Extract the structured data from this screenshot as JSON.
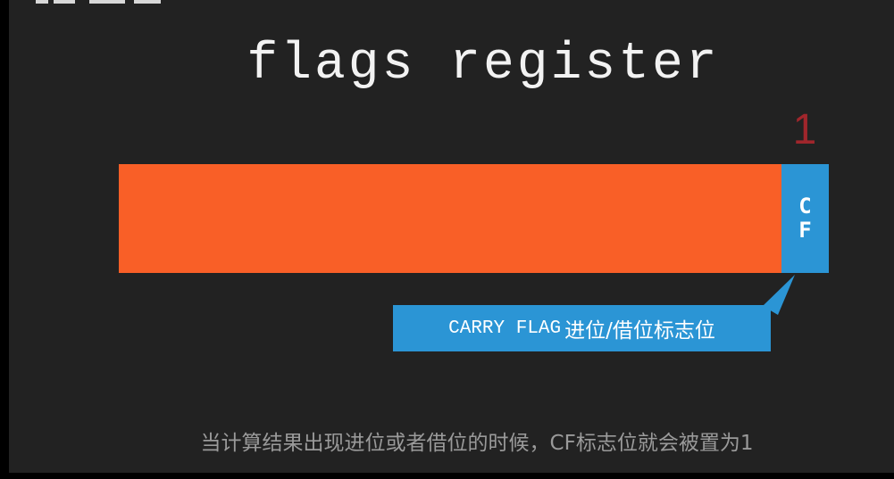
{
  "slide": {
    "title": "flags register",
    "bit_value": "1",
    "flag": {
      "abbr_letter_1": "C",
      "abbr_letter_2": "F"
    },
    "callout": {
      "label_en": "CARRY FLAG",
      "label_cn": "进位/借位标志位"
    },
    "subtitle": "当计算结果出现进位或者借位的时候，CF标志位就会被置为1"
  },
  "colors": {
    "background": "#222222",
    "register_bar": "#f95f27",
    "flag_bit": "#2b95d5",
    "bit_value": "#a0262c",
    "title_text": "#f2f2f2",
    "subtitle_text": "#9a9a9a"
  }
}
